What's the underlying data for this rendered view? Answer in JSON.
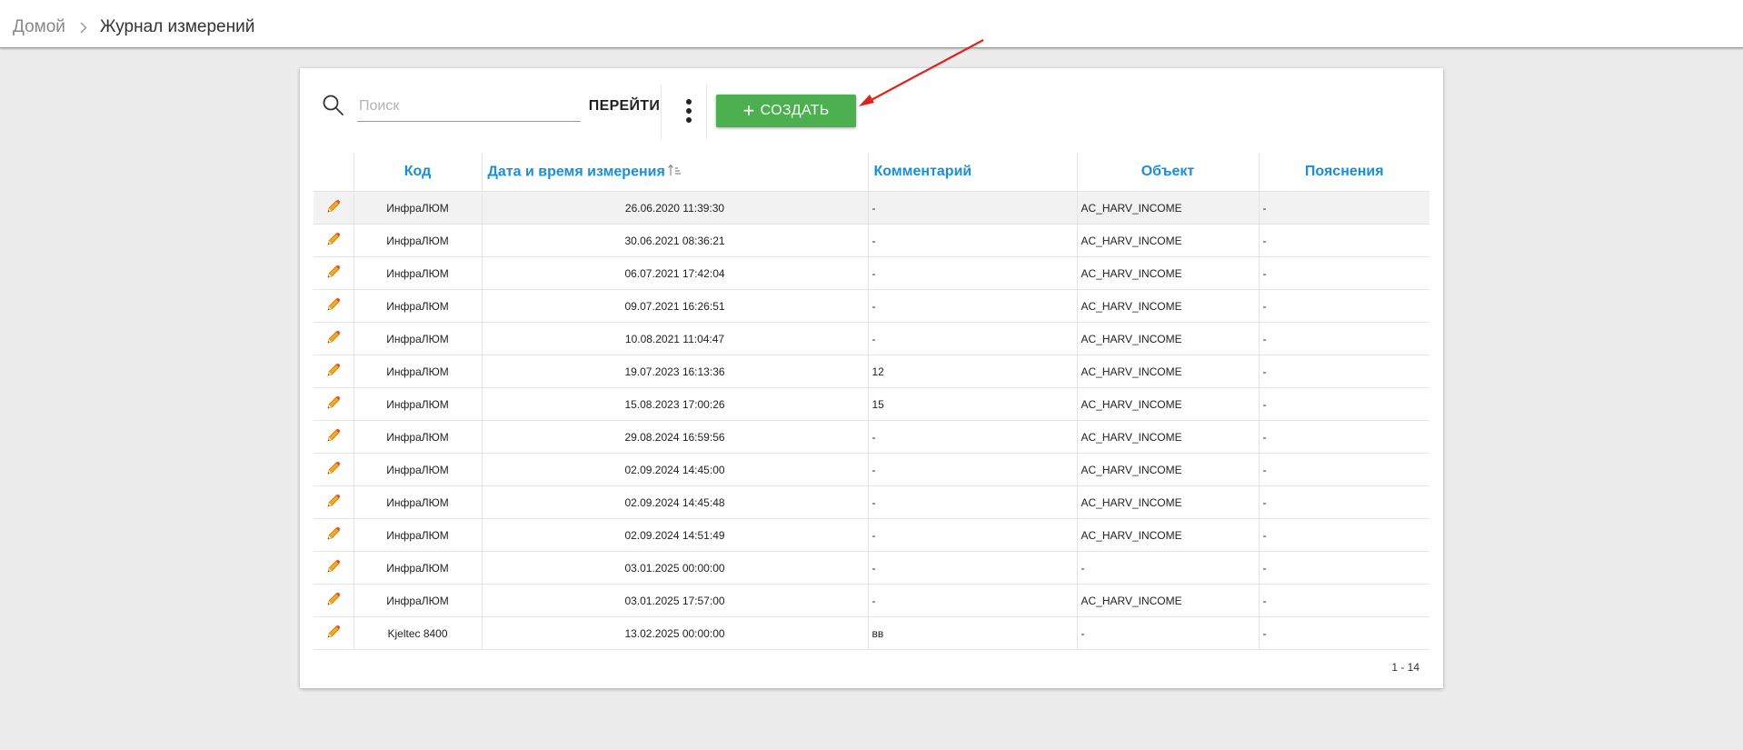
{
  "breadcrumb": {
    "home": "Домой",
    "current": "Журнал измерений"
  },
  "toolbar": {
    "search_placeholder": "Поиск",
    "go_label": "ПЕРЕЙТИ",
    "create_label": "СОЗДАТЬ",
    "create_plus": "+",
    "create_color": "#4caf50"
  },
  "table": {
    "headers": {
      "code": "Код",
      "datetime": "Дата и время измерения",
      "comment": "Комментарий",
      "object": "Объект",
      "notes": "Пояснения"
    },
    "rows": [
      {
        "code": "ИнфраЛЮМ",
        "datetime": "26.06.2020 11:39:30",
        "comment": "-",
        "object": "AC_HARV_INCOME",
        "notes": "-"
      },
      {
        "code": "ИнфраЛЮМ",
        "datetime": "30.06.2021 08:36:21",
        "comment": "-",
        "object": "AC_HARV_INCOME",
        "notes": "-"
      },
      {
        "code": "ИнфраЛЮМ",
        "datetime": "06.07.2021 17:42:04",
        "comment": "-",
        "object": "AC_HARV_INCOME",
        "notes": "-"
      },
      {
        "code": "ИнфраЛЮМ",
        "datetime": "09.07.2021 16:26:51",
        "comment": "-",
        "object": "AC_HARV_INCOME",
        "notes": "-"
      },
      {
        "code": "ИнфраЛЮМ",
        "datetime": "10.08.2021 11:04:47",
        "comment": "-",
        "object": "AC_HARV_INCOME",
        "notes": "-"
      },
      {
        "code": "ИнфраЛЮМ",
        "datetime": "19.07.2023 16:13:36",
        "comment": "12",
        "object": "AC_HARV_INCOME",
        "notes": "-"
      },
      {
        "code": "ИнфраЛЮМ",
        "datetime": "15.08.2023 17:00:26",
        "comment": "15",
        "object": "AC_HARV_INCOME",
        "notes": "-"
      },
      {
        "code": "ИнфраЛЮМ",
        "datetime": "29.08.2024 16:59:56",
        "comment": "-",
        "object": "AC_HARV_INCOME",
        "notes": "-"
      },
      {
        "code": "ИнфраЛЮМ",
        "datetime": "02.09.2024 14:45:00",
        "comment": "-",
        "object": "AC_HARV_INCOME",
        "notes": "-"
      },
      {
        "code": "ИнфраЛЮМ",
        "datetime": "02.09.2024 14:45:48",
        "comment": "-",
        "object": "AC_HARV_INCOME",
        "notes": "-"
      },
      {
        "code": "ИнфраЛЮМ",
        "datetime": "02.09.2024 14:51:49",
        "comment": "-",
        "object": "AC_HARV_INCOME",
        "notes": "-"
      },
      {
        "code": "ИнфраЛЮМ",
        "datetime": "03.01.2025 00:00:00",
        "comment": "-",
        "object": "-",
        "notes": "-"
      },
      {
        "code": "ИнфраЛЮМ",
        "datetime": "03.01.2025 17:57:00",
        "comment": "-",
        "object": "AC_HARV_INCOME",
        "notes": "-"
      },
      {
        "code": "Kjeltec 8400",
        "datetime": "13.02.2025 00:00:00",
        "comment": "вв",
        "object": "-",
        "notes": "-"
      }
    ]
  },
  "pager": {
    "range": "1 - 14"
  },
  "icons": {
    "search": "search-icon",
    "edit": "pencil-icon",
    "more": "kebab-menu-icon",
    "sort": "sort-ascending-icon",
    "chevron": "chevron-right-icon"
  }
}
